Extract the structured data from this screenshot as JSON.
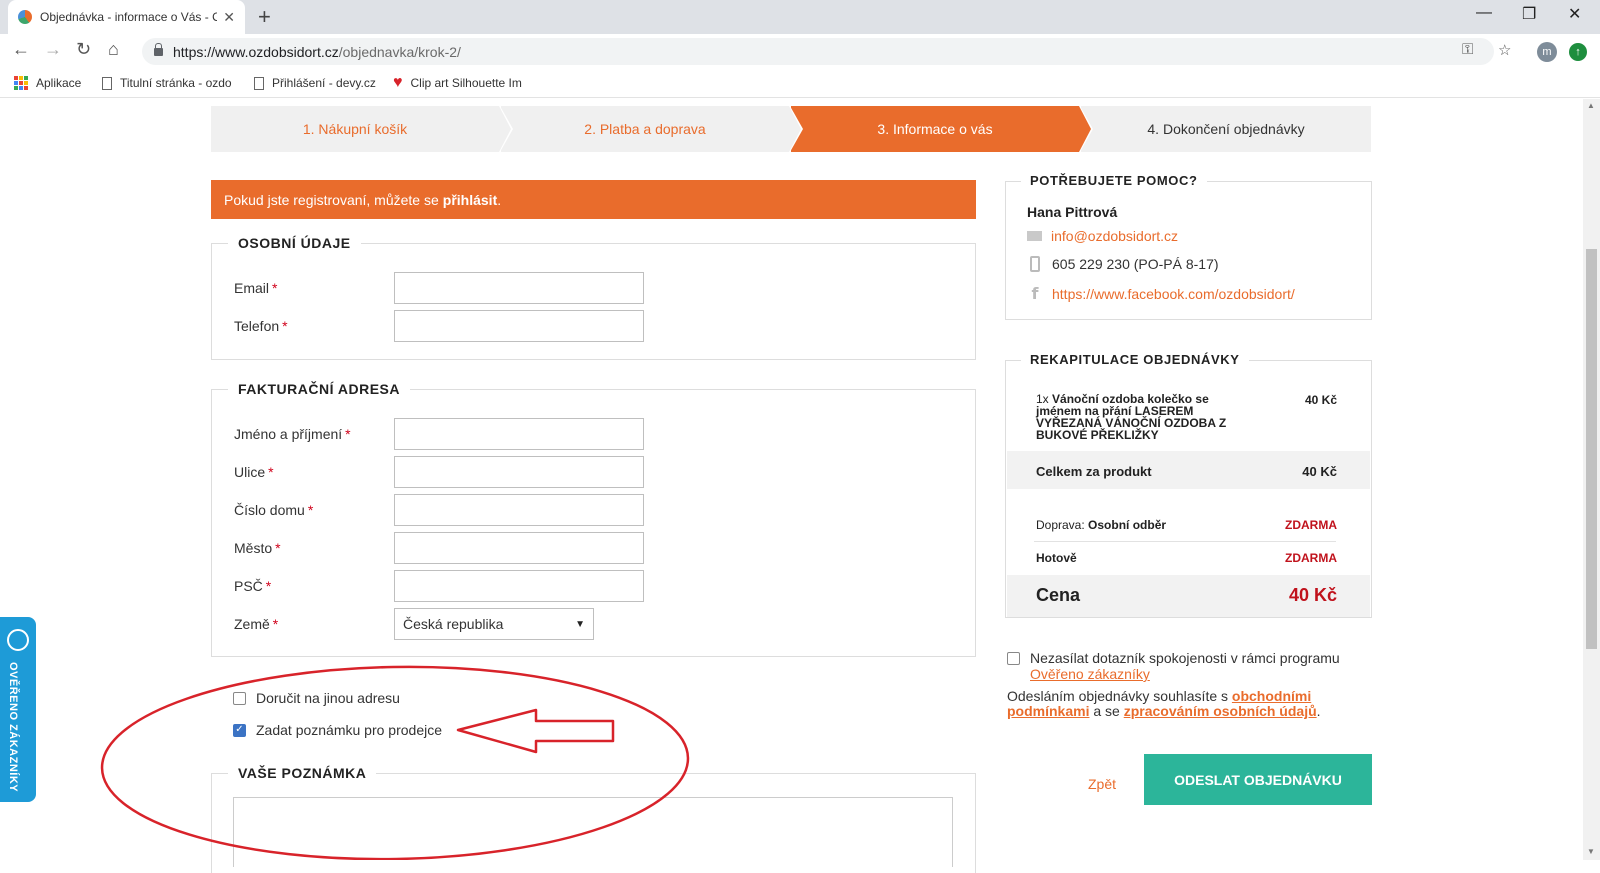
{
  "browser": {
    "tab_title": "Objednávka - informace o Vás - O",
    "url_host": "https://www.ozdobsidort.cz",
    "url_path": "/objednavka/krok-2/",
    "avatar_letter": "m",
    "bookmarks": [
      "Aplikace",
      "Titulní stránka - ozdo",
      "Přihlášení - devy.cz",
      "Clip art Silhouette Im"
    ]
  },
  "steps": [
    "1. Nákupní košík",
    "2. Platba a doprava",
    "3. Informace o vás",
    "4. Dokončení objednávky"
  ],
  "active_step": 3,
  "notice": {
    "text": "Pokud jste registrovaní, můžete se",
    "link": "přihlásit",
    "end": "."
  },
  "personal": {
    "legend": "OSOBNÍ ÚDAJE",
    "fields": [
      "Email",
      "Telefon"
    ]
  },
  "billing": {
    "legend": "FAKTURAČNÍ ADRESA",
    "fields": [
      "Jméno a příjmení",
      "Ulice",
      "Číslo domu",
      "Město",
      "PSČ"
    ],
    "country_label": "Země",
    "country_value": "Česká republika"
  },
  "required_mark": "*",
  "checkboxes": {
    "other_address": "Doručit na jinou adresu",
    "note_for_seller": "Zadat poznámku pro prodejce"
  },
  "note": {
    "legend": "VAŠE POZNÁMKA"
  },
  "help": {
    "legend": "POTŘEBUJETE POMOC?",
    "name": "Hana Pittrová",
    "email": "info@ozdobsidort.cz",
    "phone": "605 229 230 (PO-PÁ 8-17)",
    "facebook": "https://www.facebook.com/ozdobsidort/"
  },
  "summary": {
    "legend": "REKAPITULACE OBJEDNÁVKY",
    "qty": "1x",
    "product": "Vánoční ozdoba kolečko se jménem na přání LASEREM VYŘEZANÁ VÁNOČNÍ OZDOBA Z BUKOVÉ PŘEKLIŽKY",
    "product_price": "40 Kč",
    "subtotal_label": "Celkem za produkt",
    "subtotal_value": "40 Kč",
    "shipping_label": "Doprava:",
    "shipping_method": "Osobní odběr",
    "shipping_value": "ZDARMA",
    "payment_label": "Hotově",
    "payment_value": "ZDARMA",
    "total_label": "Cena",
    "total_value": "40 Kč"
  },
  "survey": {
    "text": "Nezasílat dotazník spokojenosti v rámci programu",
    "link": "Ověřeno zákazníky"
  },
  "terms": {
    "t1": "Odesláním objednávky souhlasíte s",
    "l1": "obchodními podmínkami",
    "t2": "a se",
    "l2": "zpracováním osobních údajů",
    "t3": "."
  },
  "actions": {
    "back": "Zpět",
    "submit": "ODESLAT OBJEDNÁVKU"
  },
  "badge": {
    "text": "OVĚŘENO ZÁKAZNÍKY"
  },
  "colors": {
    "accent": "#e96c2c",
    "submit": "#2cb59a",
    "price_red": "#c0121c",
    "badge": "#1e9bd7",
    "annotation": "#d8232a"
  }
}
